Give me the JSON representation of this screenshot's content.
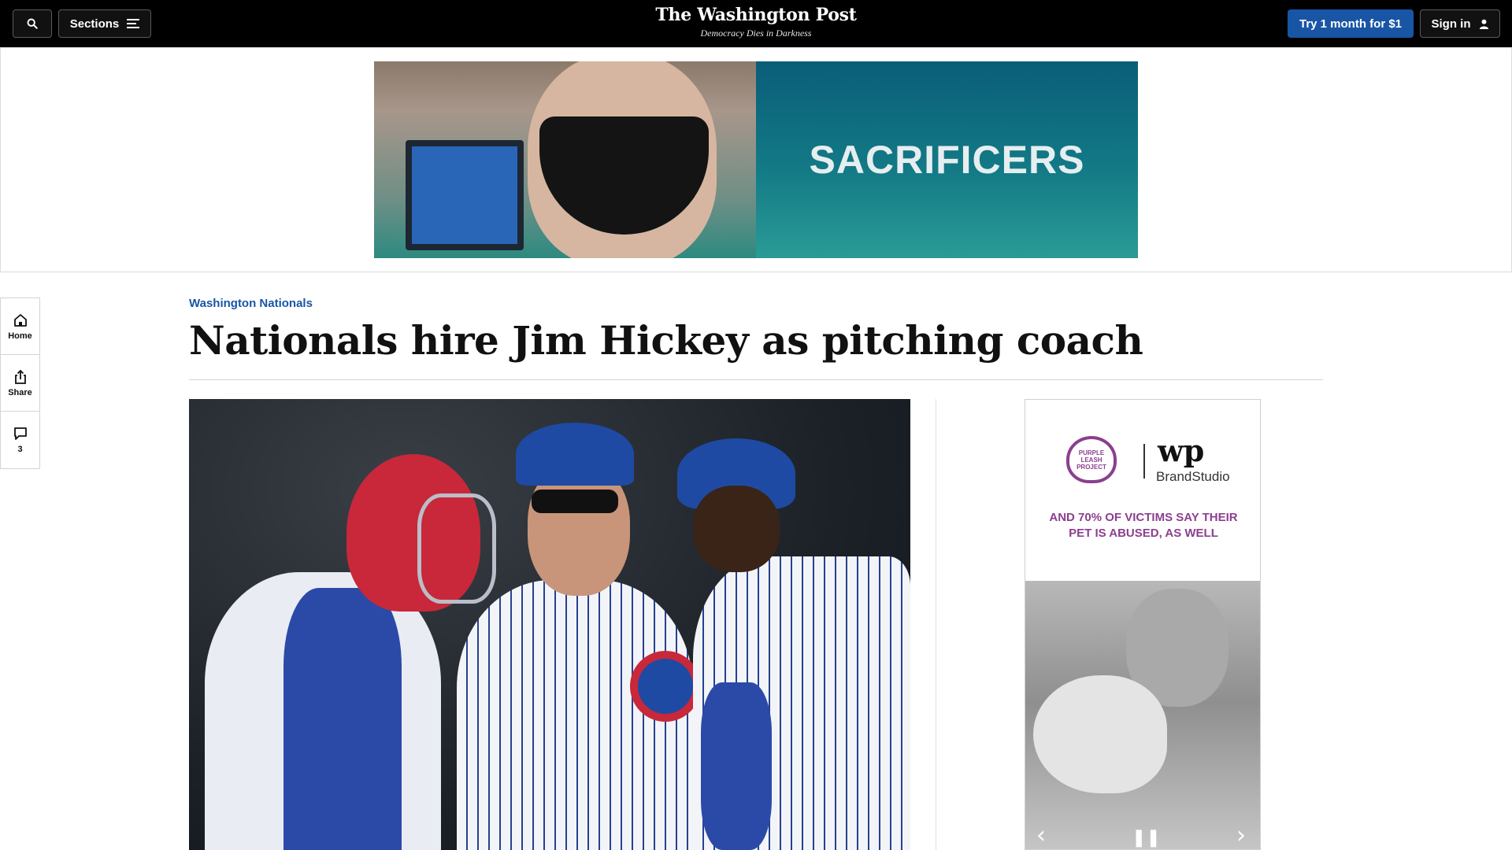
{
  "header": {
    "search_icon": "search-icon",
    "sections_label": "Sections",
    "sections_icon": "menu-icon",
    "logo": "The Washington Post",
    "tagline": "Democracy Dies in Darkness",
    "subscribe_label": "Try 1 month for $1",
    "signin_label": "Sign in",
    "signin_icon": "user-icon"
  },
  "top_ad": {
    "headline": "SACRIFICERS"
  },
  "side_rail": {
    "home_label": "Home",
    "share_label": "Share",
    "comments_count": "3"
  },
  "article": {
    "kicker": "Washington Nationals",
    "headline": "Nationals hire Jim Hickey as pitching coach"
  },
  "side_ad": {
    "org_name": "PURPLE LEASH PROJECT",
    "brand_mark": "wp",
    "brand_studio": "BrandStudio",
    "claim": "AND 70% OF VICTIMS SAY THEIR PET IS ABUSED, AS WELL"
  },
  "colors": {
    "accent": "#1955a5",
    "topbar": "#000000",
    "ad_purple": "#8c3f8e"
  }
}
